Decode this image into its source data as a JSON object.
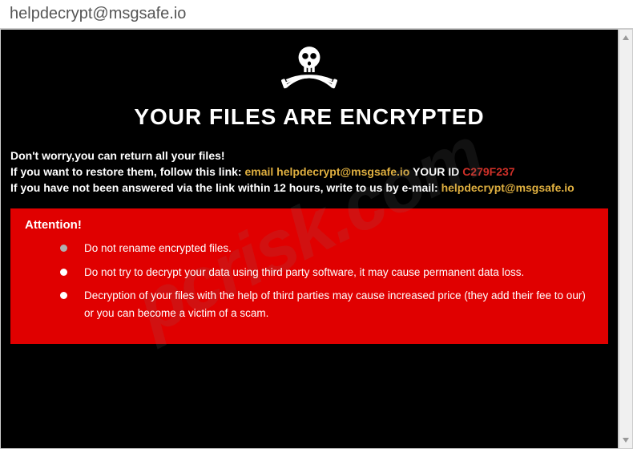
{
  "window": {
    "title": "helpdecrypt@msgsafe.io"
  },
  "page": {
    "heading": "YOUR FILES ARE ENCRYPTED",
    "line1": "Don't worry,you can return all your files!",
    "line2_prefix": "If you want to restore them, follow this link: ",
    "line2_email_label": "email ",
    "line2_email": "helpdecrypt@msgsafe.io",
    "line2_id_label": "  YOUR ID ",
    "line2_id": "C279F237",
    "line3_prefix": "If you have not been answered via the link within 12 hours, write to us by e-mail: ",
    "line3_email": "helpdecrypt@msgsafe.io"
  },
  "attention": {
    "title": "Attention!",
    "bullets": [
      "Do not rename encrypted files.",
      "Do not try to decrypt your data using third party software, it may cause permanent data loss.",
      "Decryption of your files with the help of third parties may cause increased price (they add their fee to our) or you can become a victim of a scam."
    ]
  },
  "watermark": "pcrisk.com",
  "colors": {
    "gold": "#e0b040",
    "red_id": "#d03028",
    "attention_bg": "#e00000"
  }
}
